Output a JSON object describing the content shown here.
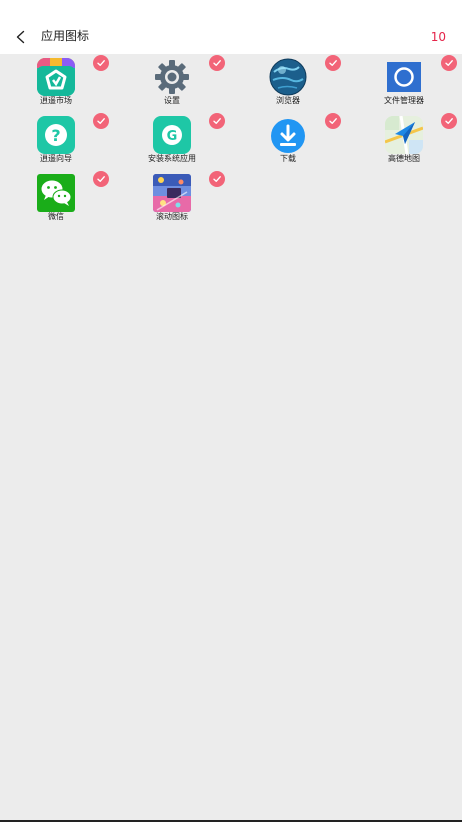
{
  "header": {
    "back_icon": "chevron-left-icon",
    "title": "应用图标",
    "selected_count": "10"
  },
  "colors": {
    "accent": "#e5254a",
    "check_badge": "#f26478",
    "background": "#ececec"
  },
  "apps": [
    {
      "label": "逍遥市场",
      "icon": "market-icon",
      "selected": true
    },
    {
      "label": "设置",
      "icon": "gear-icon",
      "selected": true
    },
    {
      "label": "浏览器",
      "icon": "globe-icon",
      "selected": true
    },
    {
      "label": "文件管理器",
      "icon": "file-manager-icon",
      "selected": true
    },
    {
      "label": "逍遥向导",
      "icon": "question-icon",
      "selected": true
    },
    {
      "label": "安装系统应用",
      "icon": "install-g-icon",
      "selected": true
    },
    {
      "label": "下载",
      "icon": "download-icon",
      "selected": true
    },
    {
      "label": "高德地图",
      "icon": "map-icon",
      "selected": true
    },
    {
      "label": "微信",
      "icon": "wechat-icon",
      "selected": true
    },
    {
      "label": "滚动图标",
      "icon": "scroll-icon",
      "selected": true
    }
  ]
}
